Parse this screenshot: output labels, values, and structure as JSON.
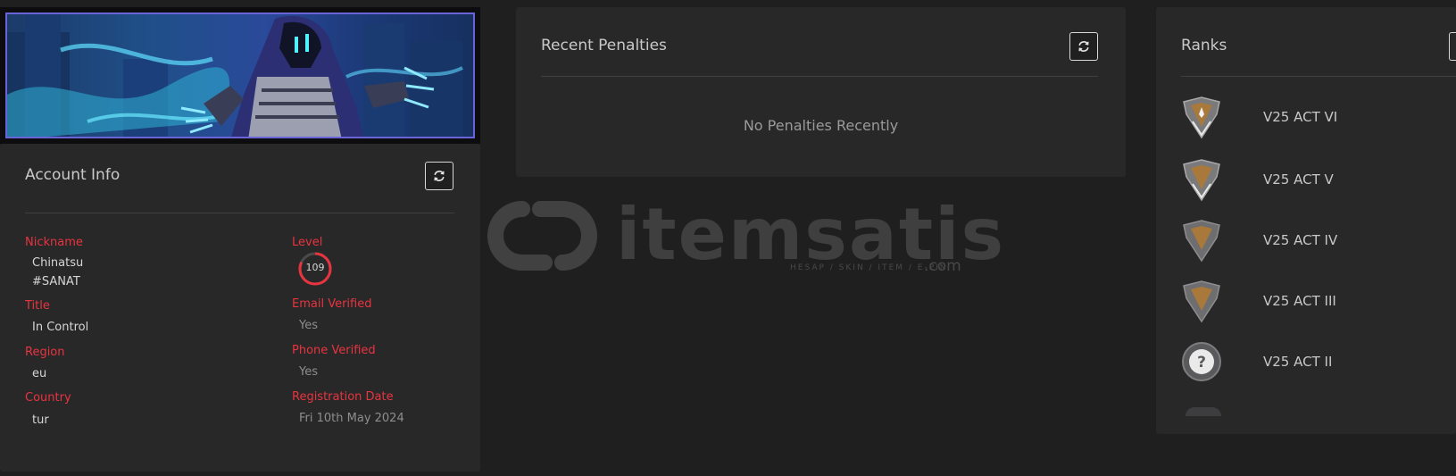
{
  "account_info": {
    "title": "Account Info",
    "fields": {
      "nickname": {
        "label": "Nickname",
        "value_line1": "Chinatsu",
        "value_line2": "#SANAT"
      },
      "level": {
        "label": "Level",
        "value": "109",
        "progress": 0.82
      },
      "title": {
        "label": "Title",
        "value": "In Control"
      },
      "email_verified": {
        "label": "Email Verified",
        "value": "Yes"
      },
      "region": {
        "label": "Region",
        "value": "eu"
      },
      "phone_verified": {
        "label": "Phone Verified",
        "value": "Yes"
      },
      "country": {
        "label": "Country",
        "value": "tur"
      },
      "registration_date": {
        "label": "Registration Date",
        "value": "Fri 10th May 2024"
      }
    }
  },
  "recent_penalties": {
    "title": "Recent Penalties",
    "empty_message": "No Penalties Recently"
  },
  "ranks": {
    "title": "Ranks",
    "items": [
      {
        "name": "V25 ACT VI",
        "icon": "rank-diamond-icon"
      },
      {
        "name": "V25 ACT V",
        "icon": "rank-diamond-icon"
      },
      {
        "name": "V25 ACT IV",
        "icon": "rank-diamond-icon"
      },
      {
        "name": "V25 ACT III",
        "icon": "rank-diamond-icon"
      },
      {
        "name": "V25 ACT II",
        "icon": "unranked-question-icon"
      }
    ]
  },
  "watermark": {
    "brand": "itemsatis",
    "tagline": "HESAP / SKIN / ITEM / E-PIN",
    "suffix": ".com"
  },
  "colors": {
    "accent_red": "#e8343f",
    "panel_bg": "#282829",
    "page_bg": "#1f1f20"
  }
}
